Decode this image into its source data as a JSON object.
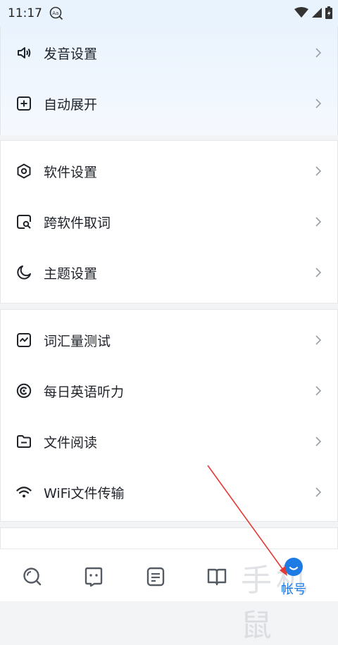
{
  "status_bar": {
    "time": "11:17"
  },
  "settings": {
    "group1": [
      {
        "label": "发音设置",
        "icon": "speaker-icon"
      },
      {
        "label": "自动展开",
        "icon": "plus-square-icon"
      }
    ],
    "group2": [
      {
        "label": "软件设置",
        "icon": "hexagon-settings-icon"
      },
      {
        "label": "跨软件取词",
        "icon": "search-square-icon"
      },
      {
        "label": "主题设置",
        "icon": "moon-icon"
      }
    ],
    "group3": [
      {
        "label": "词汇量测试",
        "icon": "chart-box-icon"
      },
      {
        "label": "每日英语听力",
        "icon": "headphone-circle-icon"
      },
      {
        "label": "文件阅读",
        "icon": "folder-icon"
      },
      {
        "label": "WiFi文件传输",
        "icon": "wifi-icon"
      }
    ]
  },
  "tabbar": {
    "tabs": [
      {
        "icon": "search-tab-icon"
      },
      {
        "icon": "robot-tab-icon"
      },
      {
        "icon": "note-tab-icon"
      },
      {
        "icon": "book-tab-icon"
      },
      {
        "icon": "account-tab-icon",
        "label": "帐号",
        "active": true
      }
    ]
  },
  "watermark": "手机鼠",
  "colors": {
    "accent": "#1e7be6",
    "annotation_arrow": "#e53935"
  }
}
